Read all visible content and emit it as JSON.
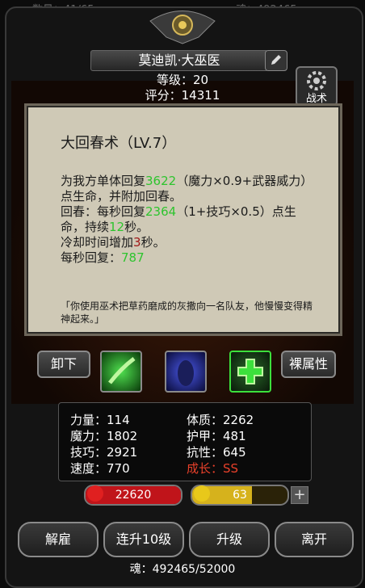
{
  "topbar": {
    "left_text": "数量：41/65",
    "right_text": "魂：492465"
  },
  "character": {
    "name": "莫迪凯·大巫医",
    "level": "等级：20",
    "score": "评分：14311"
  },
  "skill_button_label": "战术",
  "popup": {
    "title": "大回春术（LV.7）",
    "line1_a": "为我方单体回复",
    "line1_val": "3622",
    "line1_b": "（魔力×0.9+武器威力）点生命，并附加回春。",
    "line2_a": "回春：每秒回复",
    "line2_val": "2364",
    "line2_b": "（1+技巧×0.5）点生命，持续",
    "line2_val2": "12",
    "line2_c": "秒。",
    "line3_a": "冷却时间增加",
    "line3_val": "3",
    "line3_b": "秒。",
    "line4_a": "每秒回复：",
    "line4_val": "787",
    "flavor": "「你使用巫术把草药磨成的灰撒向一名队友，他慢慢变得精神起来。」"
  },
  "buttons": {
    "unequip": "卸下",
    "base_attr": "裸属性"
  },
  "stats": {
    "strength": "力量：114",
    "constitution": "体质：2262",
    "magic": "魔力：1802",
    "armor": "护甲：481",
    "skill": "技巧：2921",
    "resist": "抗性：645",
    "speed": "速度：770",
    "growth": "成长：SS"
  },
  "hp": {
    "value": "22620",
    "fill": 1.0,
    "color": "#c0141a"
  },
  "energy": {
    "value": "63",
    "fill": 0.63,
    "color": "#d6b21c"
  },
  "actions": {
    "dismiss": "解雇",
    "level_up_10": "连升10级",
    "level_up": "升级",
    "leave": "离开"
  },
  "soul_footer": "魂：492465/52000",
  "colors": {
    "green": "#2ec42e",
    "red": "#a01818",
    "growth": "#e8402a"
  }
}
